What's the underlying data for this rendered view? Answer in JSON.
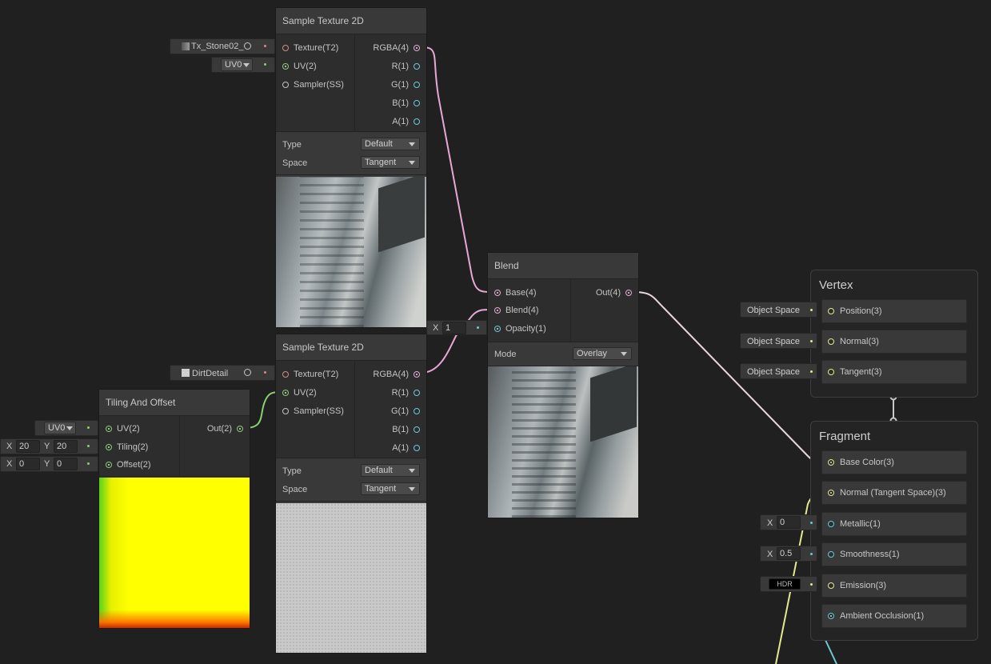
{
  "colors": {
    "background": "#202020",
    "node_body": "#393939",
    "port_area": "#2d2d2d",
    "wire_texture": "#d98a8a",
    "wire_vector2": "#8ad06e",
    "wire_vector4": "#e8a8d6",
    "wire_vector3": "#e6e890",
    "wire_float": "#6cc8d6"
  },
  "sample_texture_1": {
    "title": "Sample Texture 2D",
    "inputs": [
      "Texture(T2)",
      "UV(2)",
      "Sampler(SS)"
    ],
    "outputs": [
      "RGBA(4)",
      "R(1)",
      "G(1)",
      "B(1)",
      "A(1)"
    ],
    "type_label": "Type",
    "type_value": "Default",
    "space_label": "Space",
    "space_value": "Tangent",
    "texture_input": "Tx_Stone02_",
    "uv_input": "UV0"
  },
  "sample_texture_2": {
    "title": "Sample Texture 2D",
    "inputs": [
      "Texture(T2)",
      "UV(2)",
      "Sampler(SS)"
    ],
    "outputs": [
      "RGBA(4)",
      "R(1)",
      "G(1)",
      "B(1)",
      "A(1)"
    ],
    "type_label": "Type",
    "type_value": "Default",
    "space_label": "Space",
    "space_value": "Tangent",
    "texture_input": "DirtDetail"
  },
  "tiling": {
    "title": "Tiling And Offset",
    "inputs": [
      "UV(2)",
      "Tiling(2)",
      "Offset(2)"
    ],
    "outputs": [
      "Out(2)"
    ],
    "uv_input": "UV0",
    "tiling_x_label": "X",
    "tiling_x": "20",
    "tiling_y_label": "Y",
    "tiling_y": "20",
    "offset_x_label": "X",
    "offset_x": "0",
    "offset_y_label": "Y",
    "offset_y": "0"
  },
  "blend": {
    "title": "Blend",
    "inputs": [
      "Base(4)",
      "Blend(4)",
      "Opacity(1)"
    ],
    "outputs": [
      "Out(4)"
    ],
    "mode_label": "Mode",
    "mode_value": "Overlay",
    "opacity_label": "X",
    "opacity_value": "1"
  },
  "vertex": {
    "title": "Vertex",
    "blocks": [
      "Position(3)",
      "Normal(3)",
      "Tangent(3)"
    ],
    "inputs": [
      "Object Space",
      "Object Space",
      "Object Space"
    ]
  },
  "fragment": {
    "title": "Fragment",
    "blocks": [
      "Base Color(3)",
      "Normal (Tangent Space)(3)",
      "Metallic(1)",
      "Smoothness(1)",
      "Emission(3)",
      "Ambient Occlusion(1)"
    ],
    "metallic_label": "X",
    "metallic_value": "0",
    "smoothness_label": "X",
    "smoothness_value": "0.5",
    "emission_label": "HDR"
  }
}
